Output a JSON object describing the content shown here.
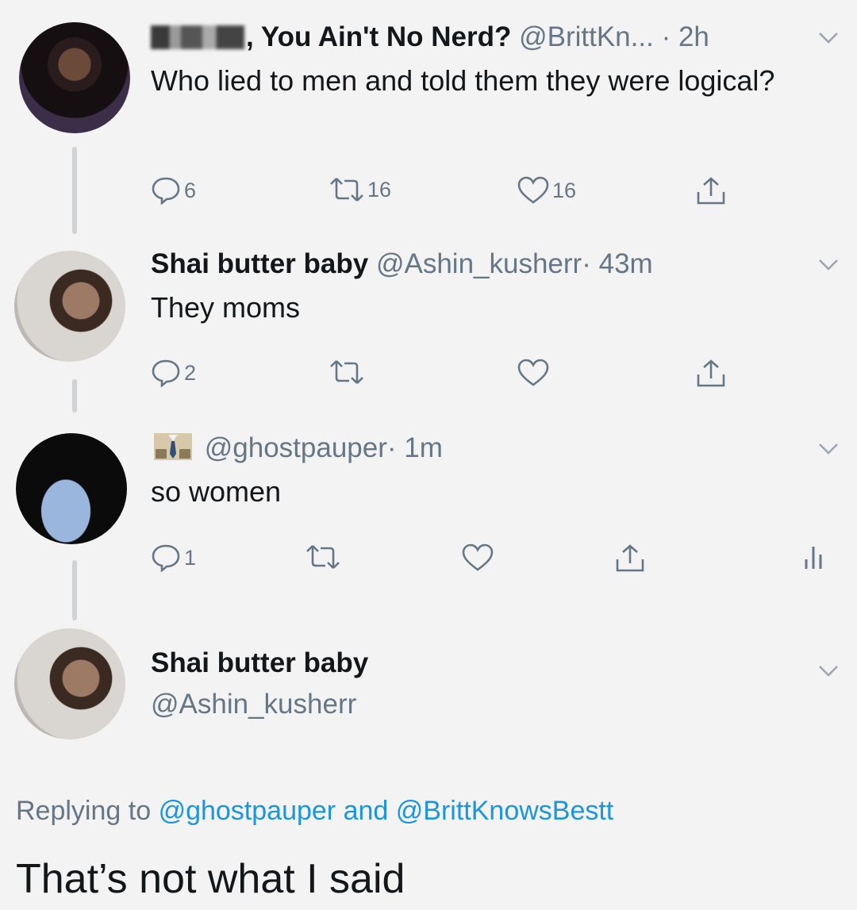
{
  "colors": {
    "link": "#1b95e0",
    "muted": "#657786",
    "text": "#14171a",
    "thread_line": "#cfd3d6"
  },
  "tweets": [
    {
      "display_name": ", You Ain't No Nerd?",
      "handle": "@BrittKn...",
      "time": "· 2h",
      "text": "Who lied to men and told them they were logical?",
      "replies": "6",
      "retweets": "16",
      "likes": "16"
    },
    {
      "display_name": "Shai butter baby",
      "handle": "@Ashin_kusherr",
      "time": "· 43m",
      "text": "They moms",
      "replies": "2",
      "retweets": "",
      "likes": ""
    },
    {
      "display_name": "",
      "handle": "@ghostpauper",
      "time": "· 1m",
      "text": "so women",
      "replies": "1",
      "retweets": "",
      "likes": ""
    }
  ],
  "main_tweet": {
    "display_name": "Shai butter baby",
    "handle": "@Ashin_kusherr",
    "replying_prefix": "Replying to",
    "replying_to_1": "@ghostpauper",
    "replying_and": "and",
    "replying_to_2": "@BrittKnowsBestt",
    "text": "That’s not what I said"
  },
  "icons": [
    "reply-icon",
    "retweet-icon",
    "like-icon",
    "share-icon",
    "analytics-icon",
    "chevron-down-icon",
    "emoji-icon"
  ]
}
